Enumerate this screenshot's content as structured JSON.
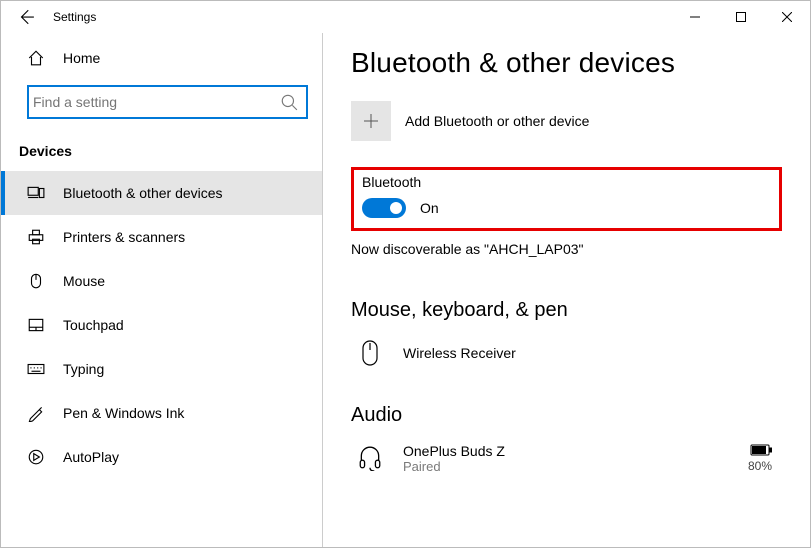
{
  "titlebar": {
    "title": "Settings"
  },
  "sidebar": {
    "home": "Home",
    "search_placeholder": "Find a setting",
    "category": "Devices",
    "items": [
      {
        "label": "Bluetooth & other devices"
      },
      {
        "label": "Printers & scanners"
      },
      {
        "label": "Mouse"
      },
      {
        "label": "Touchpad"
      },
      {
        "label": "Typing"
      },
      {
        "label": "Pen & Windows Ink"
      },
      {
        "label": "AutoPlay"
      }
    ]
  },
  "main": {
    "title": "Bluetooth & other devices",
    "add_label": "Add Bluetooth or other device",
    "bt_heading": "Bluetooth",
    "bt_state": "On",
    "discoverable": "Now discoverable as \"AHCH_LAP03\"",
    "section_mkp": "Mouse, keyboard, & pen",
    "dev_mkp": {
      "name": "Wireless Receiver"
    },
    "section_audio": "Audio",
    "dev_audio": {
      "name": "OnePlus Buds Z",
      "status": "Paired",
      "battery": "80%"
    }
  }
}
